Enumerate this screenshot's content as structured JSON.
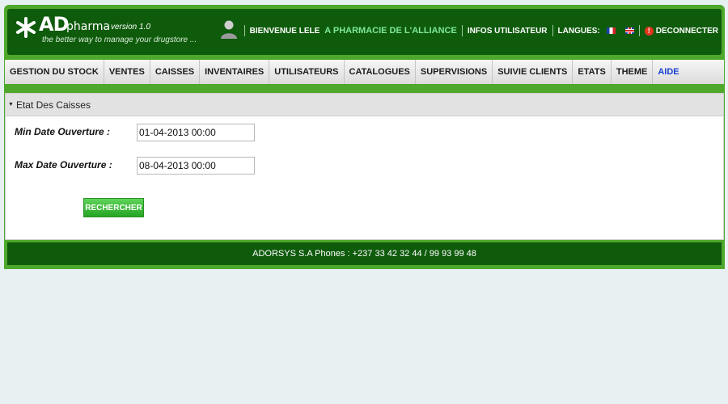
{
  "logo": {
    "ad": "AD",
    "pharma": "pharma",
    "version": "version 1.0",
    "tagline": "the better way to manage your drugstore ..."
  },
  "topbar": {
    "welcome": "BIENVENUE LELE",
    "pharmacy": "A PHARMACIE DE L'ALLIANCE",
    "user_info": "INFOS UTILISATEUR",
    "languages": "LANGUES:",
    "logout": "DECONNECTER"
  },
  "nav": {
    "items": [
      "GESTION DU STOCK",
      "VENTES",
      "CAISSES",
      "INVENTAIRES",
      "UTILISATEURS",
      "CATALOGUES",
      "SUPERVISIONS",
      "SUIVIE CLIENTS",
      "ETATS",
      "THEME",
      "AIDE"
    ]
  },
  "panel": {
    "title": "Etat Des Caisses",
    "min_label": "Min Date Ouverture :",
    "min_value": "01-04-2013 00:00",
    "max_label": "Max Date Ouverture :",
    "max_value": "08-04-2013 00:00",
    "search_button": "RECHERCHER"
  },
  "footer": {
    "text": "ADORSYS S.A Phones : +237 33 42 32 44 / 99 93 99 48"
  },
  "colors": {
    "brand_dark_green": "#0f5b0c",
    "brand_light_green": "#4ea82b",
    "pharmacy_text": "#7fe89a",
    "aide_link": "#1a3fd0",
    "button_green": "#25a524"
  }
}
